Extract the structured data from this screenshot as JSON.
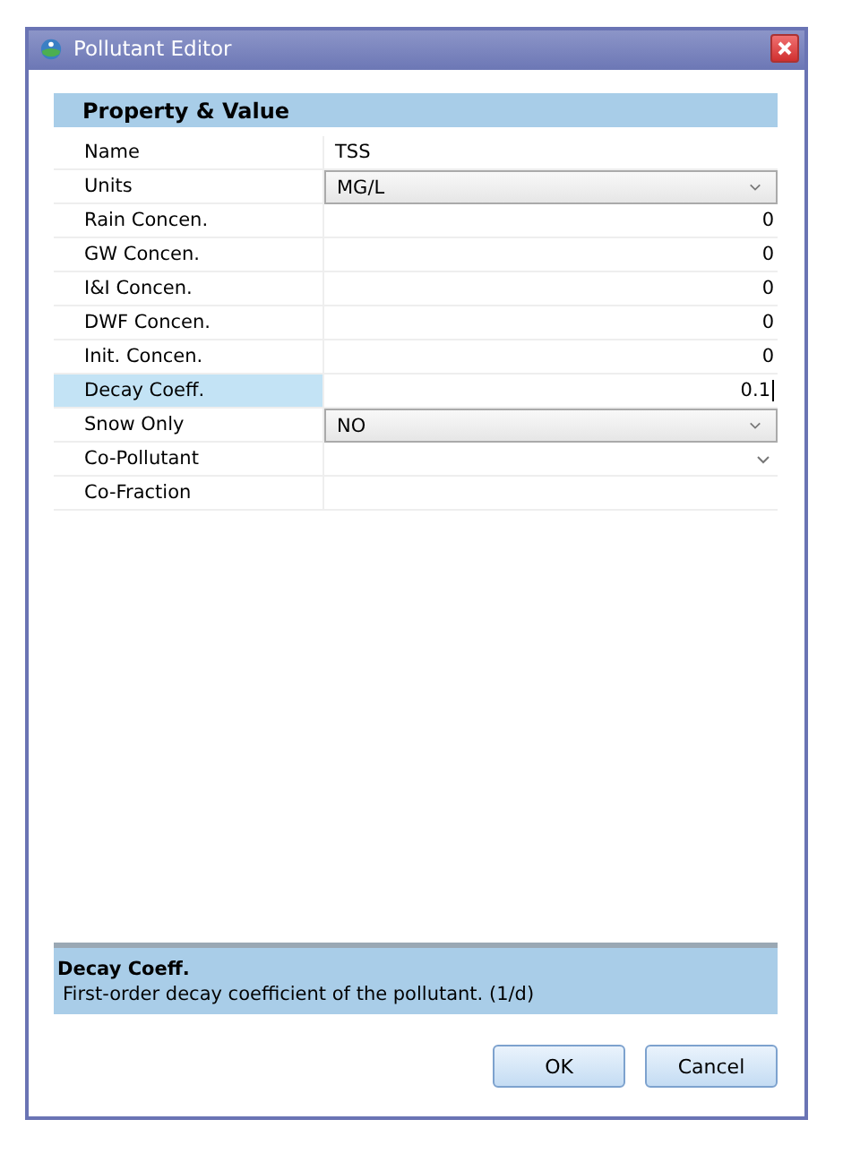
{
  "window": {
    "title": "Pollutant Editor"
  },
  "grid": {
    "header": "Property  &  Value",
    "rows": [
      {
        "label": "Name",
        "value": "TSS",
        "kind": "text",
        "selected": false
      },
      {
        "label": "Units",
        "value": "MG/L",
        "kind": "combo",
        "selected": false
      },
      {
        "label": "Rain Concen.",
        "value": "0",
        "kind": "number",
        "selected": false
      },
      {
        "label": "GW Concen.",
        "value": "0",
        "kind": "number",
        "selected": false
      },
      {
        "label": "I&I Concen.",
        "value": "0",
        "kind": "number",
        "selected": false
      },
      {
        "label": "DWF Concen.",
        "value": "0",
        "kind": "number",
        "selected": false
      },
      {
        "label": "Init. Concen.",
        "value": "0",
        "kind": "number",
        "selected": false
      },
      {
        "label": "Decay Coeff.",
        "value": "0.1",
        "kind": "number",
        "selected": true
      },
      {
        "label": "Snow Only",
        "value": "NO",
        "kind": "combo",
        "selected": false
      },
      {
        "label": "Co-Pollutant",
        "kind": "list",
        "selected": false
      },
      {
        "label": "Co-Fraction",
        "kind": "text",
        "selected": false
      }
    ]
  },
  "description": {
    "title": "Decay Coeff.",
    "text": "First-order decay coefficient of the pollutant. (1/d)"
  },
  "buttons": [
    "OK",
    "Cancel"
  ]
}
